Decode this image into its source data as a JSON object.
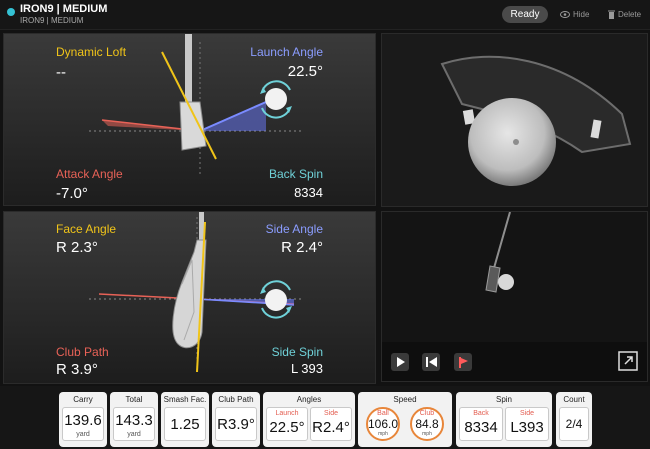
{
  "header": {
    "title": "IRON9 | MEDIUM",
    "subtitle": "IRON9 | MEDIUM",
    "ready_label": "Ready",
    "hide_label": "Hide",
    "delete_label": "Delete"
  },
  "top_panel": {
    "dynamic_loft": {
      "label": "Dynamic Loft",
      "value": "--"
    },
    "launch_angle": {
      "label": "Launch Angle",
      "value": "22.5°"
    },
    "attack_angle": {
      "label": "Attack Angle",
      "value": "-7.0°"
    },
    "back_spin": {
      "label": "Back Spin",
      "value": "8334"
    }
  },
  "bottom_panel": {
    "face_angle": {
      "label": "Face Angle",
      "value": "R 2.3°"
    },
    "side_angle": {
      "label": "Side Angle",
      "value": "R 2.4°"
    },
    "club_path": {
      "label": "Club Path",
      "value": "R 3.9°"
    },
    "side_spin": {
      "label": "Side Spin",
      "value": "L 393"
    }
  },
  "video": {
    "controls": [
      "play-icon",
      "step-back-icon",
      "flag-marker-icon",
      "fullscreen-icon"
    ]
  },
  "stats": {
    "carry": {
      "title": "Carry",
      "value": "139.6",
      "unit": "yard"
    },
    "total": {
      "title": "Total",
      "value": "143.3",
      "unit": "yard"
    },
    "smash": {
      "title": "Smash Fac.",
      "value": "1.25"
    },
    "club_path": {
      "title": "Club Path",
      "value": "R3.9°"
    },
    "angles": {
      "title": "Angles",
      "launch_label": "Launch",
      "launch_value": "22.5°",
      "side_label": "Side",
      "side_value": "R2.4°"
    },
    "speed": {
      "title": "Speed",
      "ball_label": "Ball",
      "ball_value": "106.0",
      "ball_unit": "mph",
      "club_label": "Club",
      "club_value": "84.8",
      "club_unit": "mph"
    },
    "spin": {
      "title": "Spin",
      "back_label": "Back",
      "back_value": "8334",
      "side_label": "Side",
      "side_value": "L393"
    },
    "count": {
      "title": "Count",
      "value": "2/4"
    }
  },
  "colors": {
    "accent_teal": "#34c2d4",
    "loft_yellow": "#f0c419",
    "launch_blue": "#8b9dff",
    "attack_red": "#e86257",
    "spin_teal": "#6fd1d8",
    "speed_ring": "#e8863a"
  }
}
